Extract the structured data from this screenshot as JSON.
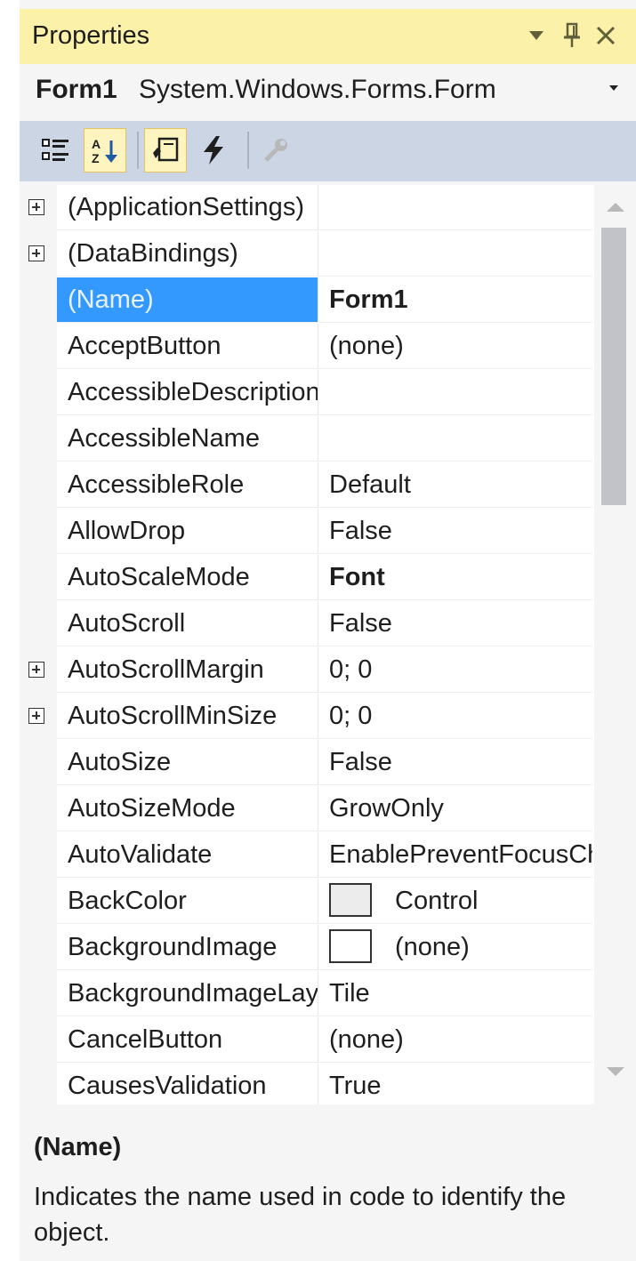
{
  "window": {
    "title": "Properties",
    "colors": {
      "title_bar": "#fcf1a8",
      "toolbar": "#ccd5e4",
      "selection": "#3399ff"
    }
  },
  "titlebar": {
    "icons": [
      "dropdown-arrow-icon",
      "pin-icon",
      "close-icon"
    ]
  },
  "object_selector": {
    "name": "Form1",
    "type": "System.Windows.Forms.Form"
  },
  "toolbar": {
    "buttons": [
      "categorized-icon",
      "alphabetical-icon",
      "properties-icon",
      "events-icon",
      "property-pages-icon"
    ],
    "active": [
      "alphabetical-icon",
      "properties-icon"
    ]
  },
  "grid": {
    "rows": [
      {
        "name": "(ApplicationSettings)",
        "value": "",
        "expandable": true
      },
      {
        "name": "(DataBindings)",
        "value": "",
        "expandable": true
      },
      {
        "name": "(Name)",
        "value": "Form1",
        "bold": true,
        "selected": true
      },
      {
        "name": "AcceptButton",
        "value": "(none)"
      },
      {
        "name": "AccessibleDescription",
        "value": ""
      },
      {
        "name": "AccessibleName",
        "value": ""
      },
      {
        "name": "AccessibleRole",
        "value": "Default"
      },
      {
        "name": "AllowDrop",
        "value": "False"
      },
      {
        "name": "AutoScaleMode",
        "value": "Font",
        "bold": true
      },
      {
        "name": "AutoScroll",
        "value": "False"
      },
      {
        "name": "AutoScrollMargin",
        "value": "0; 0",
        "expandable": true
      },
      {
        "name": "AutoScrollMinSize",
        "value": "0; 0",
        "expandable": true
      },
      {
        "name": "AutoSize",
        "value": "False"
      },
      {
        "name": "AutoSizeMode",
        "value": "GrowOnly"
      },
      {
        "name": "AutoValidate",
        "value": "EnablePreventFocusChange"
      },
      {
        "name": "BackColor",
        "value": "Control",
        "swatch": "#ececec"
      },
      {
        "name": "BackgroundImage",
        "value": "(none)",
        "swatch": "#ffffff"
      },
      {
        "name": "BackgroundImageLayout",
        "value": "Tile"
      },
      {
        "name": "CancelButton",
        "value": "(none)"
      },
      {
        "name": "CausesValidation",
        "value": "True"
      }
    ]
  },
  "description": {
    "title": "(Name)",
    "text": "Indicates the name used in code to identify the object."
  }
}
